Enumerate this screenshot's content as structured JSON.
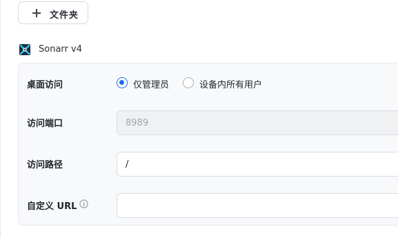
{
  "toolbar": {
    "add_folder_label": "文件夹"
  },
  "app": {
    "name": "Sonarr v4",
    "icon": "sonarr-icon"
  },
  "form": {
    "desktop_access": {
      "label": "桌面访问",
      "options": [
        {
          "label": "仅管理员",
          "checked": true
        },
        {
          "label": "设备内所有用户",
          "checked": false
        }
      ]
    },
    "access_port": {
      "label": "访问端口",
      "value": "8989"
    },
    "access_path": {
      "label": "访问路径",
      "value": "/"
    },
    "custom_url": {
      "label": "自定义 URL",
      "value": ""
    }
  },
  "colors": {
    "accent": "#1e6fe6"
  }
}
